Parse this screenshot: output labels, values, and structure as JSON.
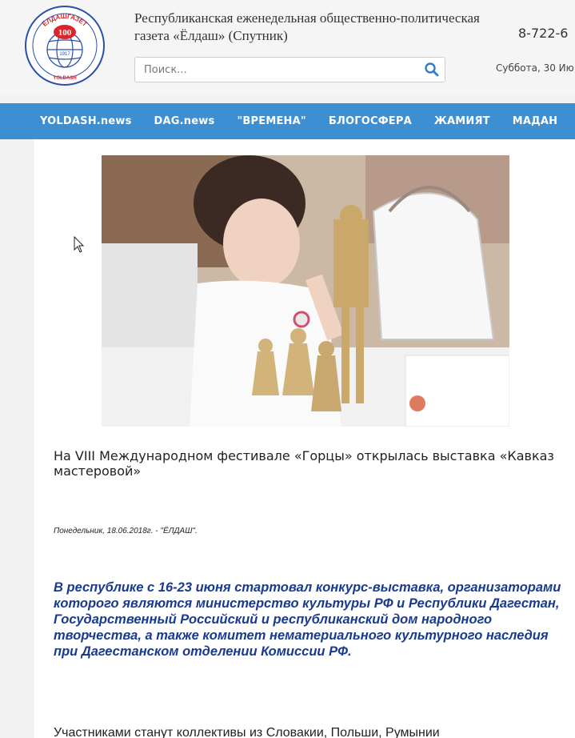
{
  "header": {
    "logo": {
      "arc_text": "ЁЛДАШГАЗЕТ",
      "number": "100",
      "year": "1917",
      "bottom_text": "YOLDASH"
    },
    "masthead": "Республиканская еженедельная общественно-политическая газета «Ёлдаш» (Спутник)",
    "phone": "8-722-6",
    "search": {
      "placeholder": "Поиск...",
      "icon": "search-icon"
    },
    "date": "Суббота, 30 Ию"
  },
  "nav": {
    "items": [
      {
        "label": "YOLDASH.news"
      },
      {
        "label": "DAG.news"
      },
      {
        "label": "\"ВРЕМЕНА\""
      },
      {
        "label": "БЛОГОСФЕРА"
      },
      {
        "label": "ЖАМИЯТ"
      },
      {
        "label": "МАДАН"
      }
    ]
  },
  "article": {
    "headline": "На VIII Международном фестивале «Горцы» открылась выставка «Кавказ мастеровой»",
    "dateline": "Понедельник, 18.06.2018г. - \"ЁЛДАШ\".",
    "lead": "В республике с 16-23 июня стартовал конкурс-выставка, организаторами которого являются министерство культуры РФ и Республики Дагестан, Государственный Российский и республиканский дом народного творчества, а также комитет нематериального культурного наследия при Дагестанском отделении Комиссии РФ.",
    "body_start": "Участниками станут коллективы из Словакии, Польши, Румынии"
  },
  "colors": {
    "nav_bg": "#3d8fd4",
    "lead_text": "#1a3a8c",
    "logo_blue": "#2a4fa8",
    "logo_red": "#d8262c"
  }
}
